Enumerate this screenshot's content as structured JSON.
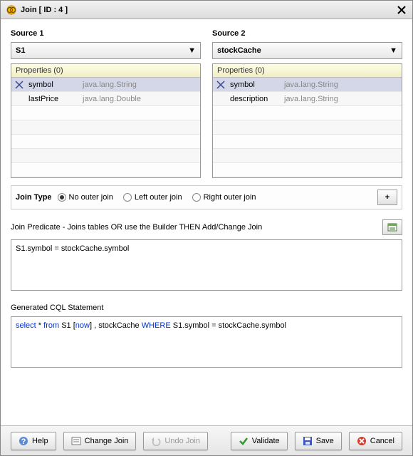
{
  "title": "Join [ ID : 4 ]",
  "source1": {
    "label": "Source 1",
    "selected": "S1",
    "properties_header": "Properties (0)",
    "rows": [
      {
        "name": "symbol",
        "type": "java.lang.String",
        "selected": true,
        "icon": true
      },
      {
        "name": "lastPrice",
        "type": "java.lang.Double",
        "selected": false,
        "icon": false
      }
    ]
  },
  "source2": {
    "label": "Source 2",
    "selected": "stockCache",
    "properties_header": "Properties (0)",
    "rows": [
      {
        "name": "symbol",
        "type": "java.lang.String",
        "selected": true,
        "icon": true
      },
      {
        "name": "description",
        "type": "java.lang.String",
        "selected": false,
        "icon": false
      }
    ]
  },
  "join_type": {
    "label": "Join Type",
    "options": {
      "no_outer": "No outer join",
      "left_outer": "Left outer join",
      "right_outer": "Right outer join"
    },
    "selected": "no_outer"
  },
  "predicate": {
    "label": "Join Predicate - Joins tables OR use the Builder THEN Add/Change Join",
    "text": "S1.symbol  =  stockCache.symbol"
  },
  "generated": {
    "label": "Generated CQL Statement",
    "tokens": [
      {
        "t": "select",
        "kw": true
      },
      {
        "t": " * "
      },
      {
        "t": "from",
        "kw": true
      },
      {
        "t": "  S1  ["
      },
      {
        "t": "now",
        "kw": true
      },
      {
        "t": "] ,  stockCache "
      },
      {
        "t": "WHERE",
        "kw": true
      },
      {
        "t": " S1.symbol  =  stockCache.symbol"
      }
    ]
  },
  "buttons": {
    "help": "Help",
    "change_join": "Change Join",
    "undo_join": "Undo Join",
    "validate": "Validate",
    "save": "Save",
    "cancel": "Cancel"
  }
}
